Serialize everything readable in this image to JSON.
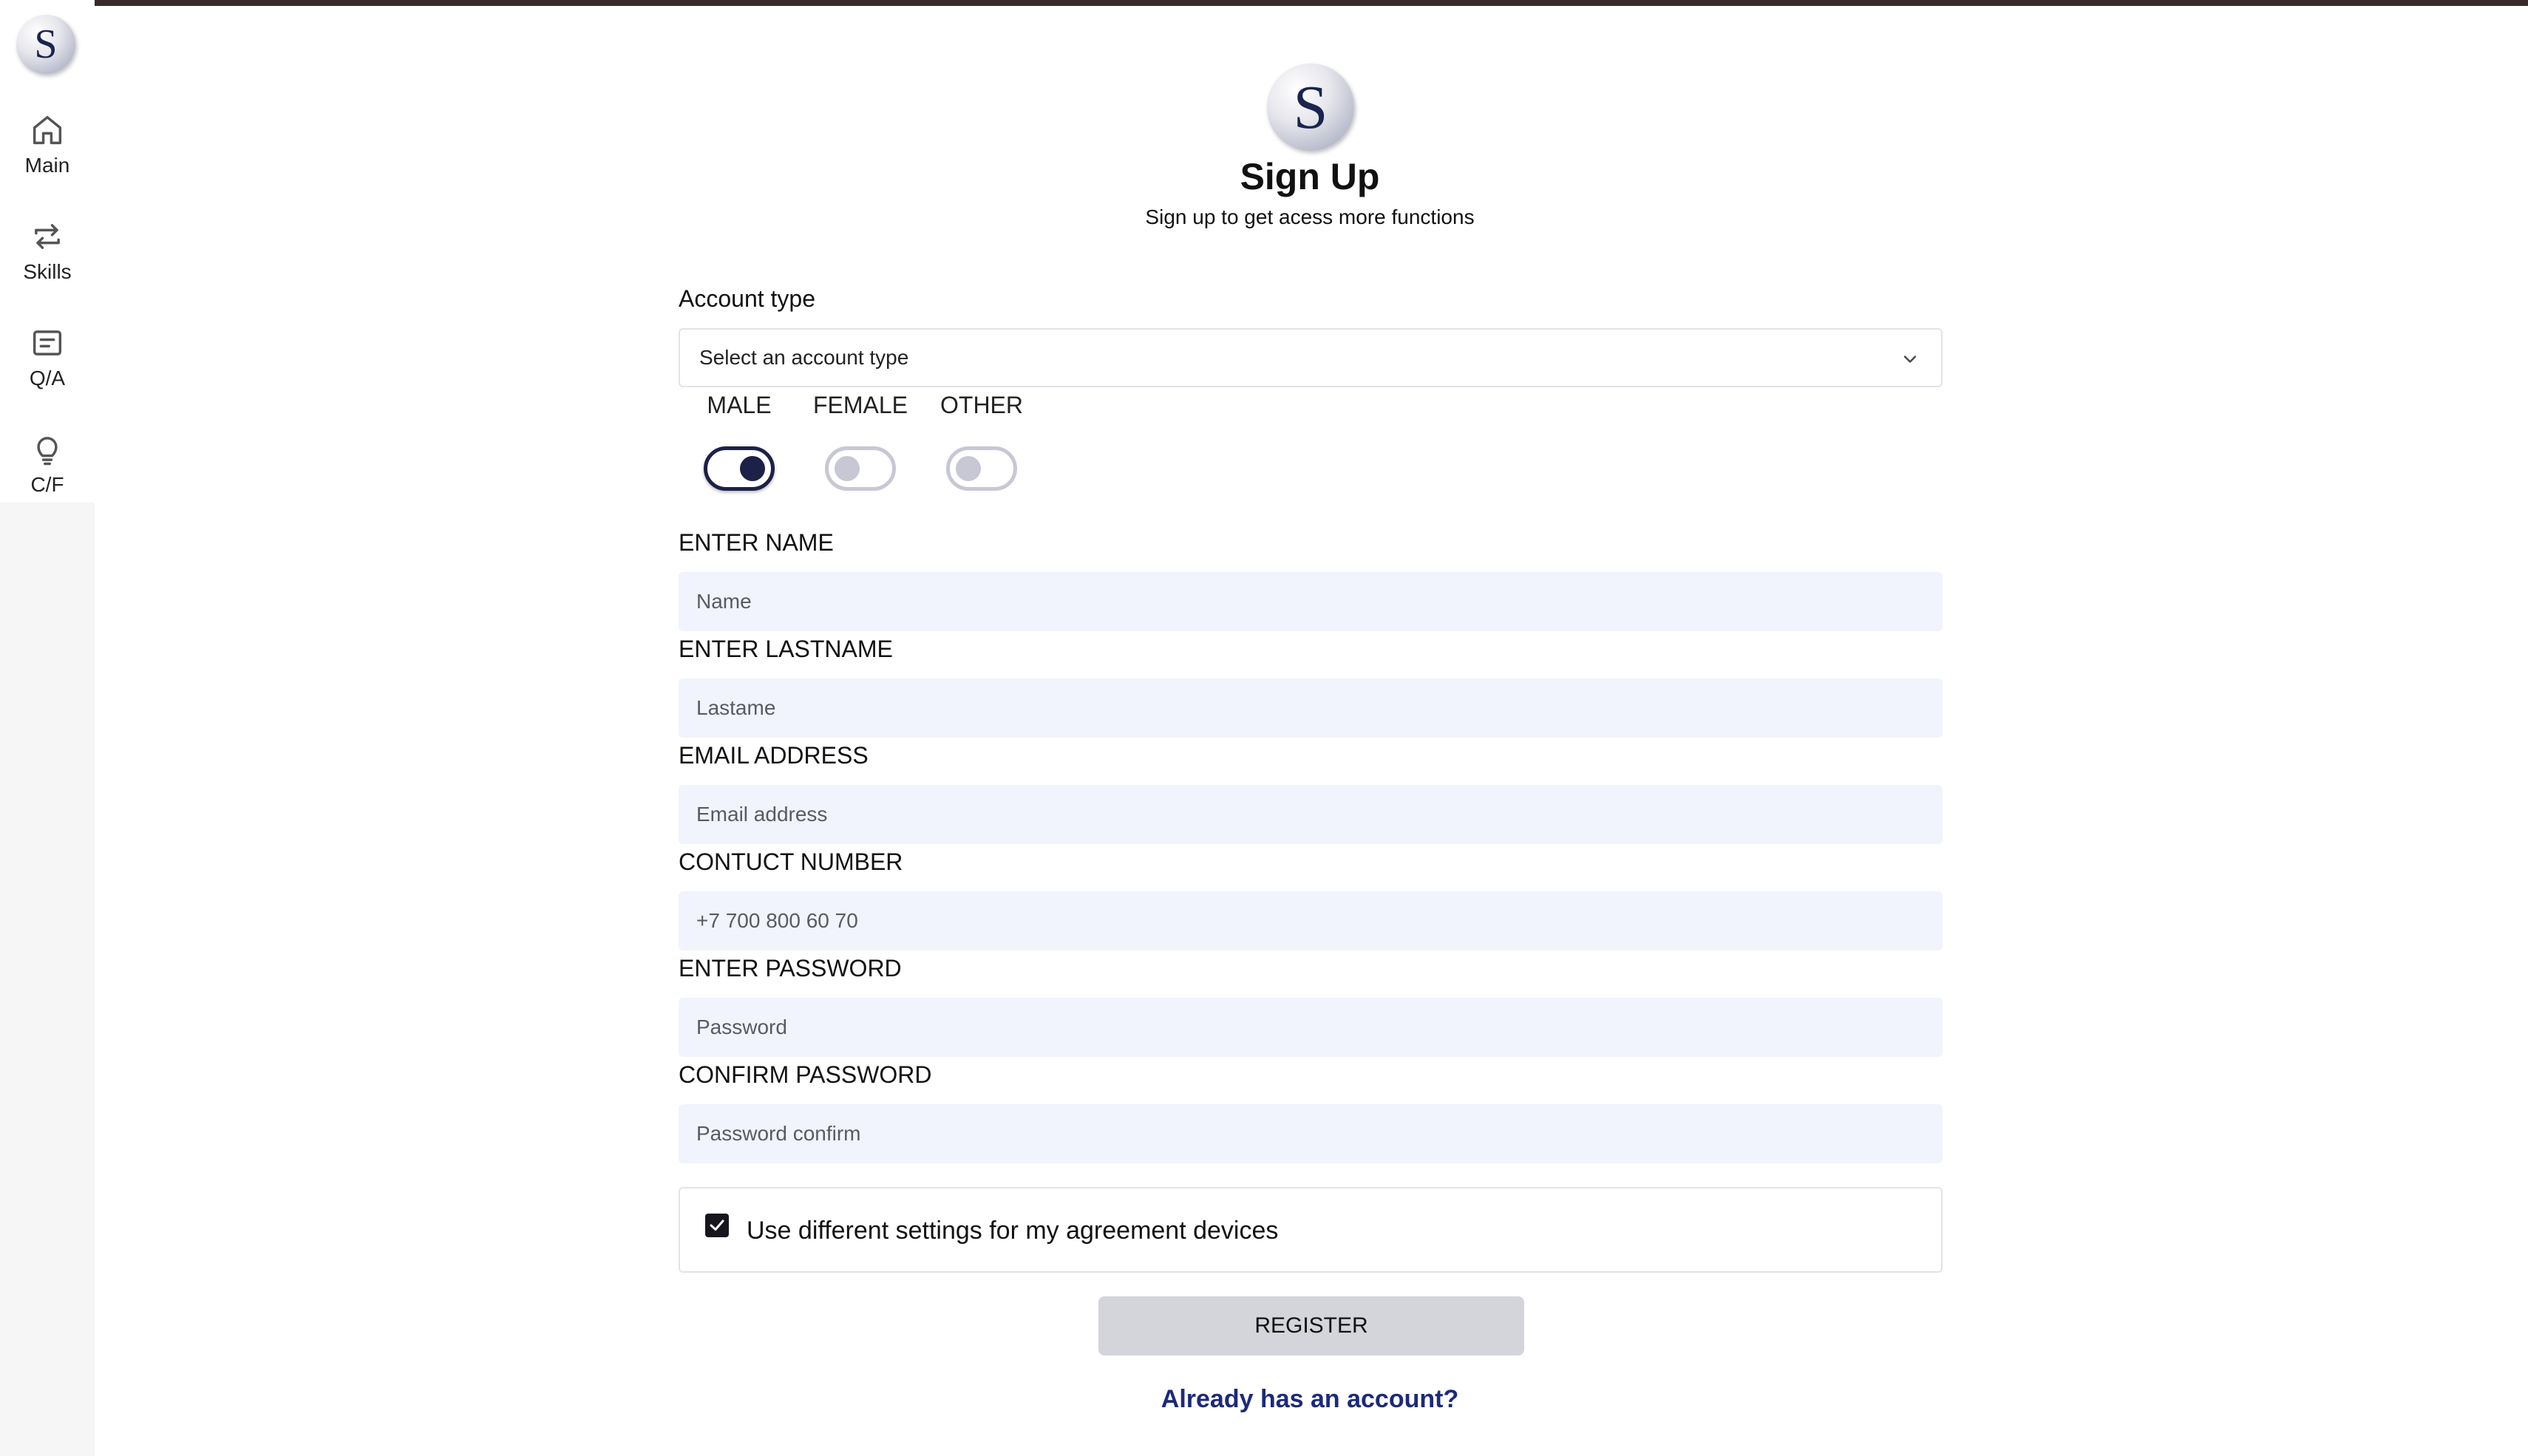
{
  "app": {
    "logo_letter": "S",
    "brand_color": "#1d2148",
    "link_color": "#1c2a78"
  },
  "sidebar": {
    "items": [
      {
        "label": "Main",
        "icon": "home-icon"
      },
      {
        "label": "Skills",
        "icon": "swap-arrows-icon"
      },
      {
        "label": "Q/A",
        "icon": "message-square-icon"
      },
      {
        "label": "C/F",
        "icon": "lightbulb-icon"
      }
    ]
  },
  "form": {
    "title": "Sign Up",
    "subtitle": "Sign up to get acess more functions",
    "account_type": {
      "label": "Account type",
      "selected": "Select an account type"
    },
    "gender": {
      "options": [
        {
          "label": "MALE",
          "checked": true
        },
        {
          "label": "FEMALE",
          "checked": false
        },
        {
          "label": "OTHER",
          "checked": false
        }
      ]
    },
    "fields": {
      "name": {
        "label": "ENTER NAME",
        "placeholder": "Name",
        "value": ""
      },
      "lastname": {
        "label": "ENTER LASTNAME",
        "placeholder": "Lastame",
        "value": ""
      },
      "email": {
        "label": "EMAIL ADDRESS",
        "placeholder": "Email address",
        "value": ""
      },
      "phone": {
        "label": "CONTUCT NUMBER",
        "placeholder": "+7 700 800 60 70",
        "value": ""
      },
      "password": {
        "label": "ENTER PASSWORD",
        "placeholder": "Password",
        "value": ""
      },
      "password_confirm": {
        "label": "CONFIRM PASSWORD",
        "placeholder": "Password confirm",
        "value": ""
      }
    },
    "agreement": {
      "label": "Use different settings for my agreement devices",
      "checked": true
    },
    "register_label": "REGISTER",
    "login_link": "Already has an account?"
  }
}
